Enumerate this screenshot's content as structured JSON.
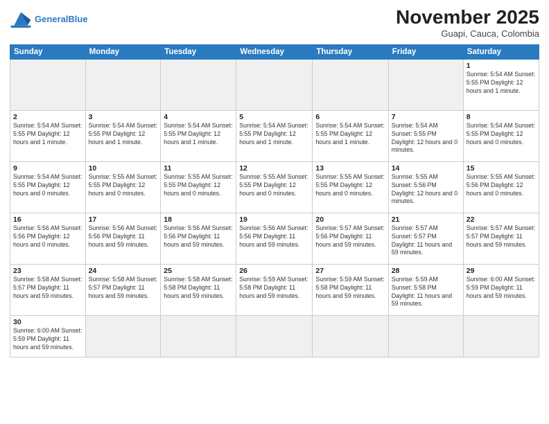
{
  "header": {
    "logo_general": "General",
    "logo_blue": "Blue",
    "month_title": "November 2025",
    "location": "Guapi, Cauca, Colombia"
  },
  "weekdays": [
    "Sunday",
    "Monday",
    "Tuesday",
    "Wednesday",
    "Thursday",
    "Friday",
    "Saturday"
  ],
  "weeks": [
    [
      {
        "day": "",
        "info": ""
      },
      {
        "day": "",
        "info": ""
      },
      {
        "day": "",
        "info": ""
      },
      {
        "day": "",
        "info": ""
      },
      {
        "day": "",
        "info": ""
      },
      {
        "day": "",
        "info": ""
      },
      {
        "day": "1",
        "info": "Sunrise: 5:54 AM\nSunset: 5:55 PM\nDaylight: 12 hours and 1 minute."
      }
    ],
    [
      {
        "day": "2",
        "info": "Sunrise: 5:54 AM\nSunset: 5:55 PM\nDaylight: 12 hours and 1 minute."
      },
      {
        "day": "3",
        "info": "Sunrise: 5:54 AM\nSunset: 5:55 PM\nDaylight: 12 hours and 1 minute."
      },
      {
        "day": "4",
        "info": "Sunrise: 5:54 AM\nSunset: 5:55 PM\nDaylight: 12 hours and 1 minute."
      },
      {
        "day": "5",
        "info": "Sunrise: 5:54 AM\nSunset: 5:55 PM\nDaylight: 12 hours and 1 minute."
      },
      {
        "day": "6",
        "info": "Sunrise: 5:54 AM\nSunset: 5:55 PM\nDaylight: 12 hours and 1 minute."
      },
      {
        "day": "7",
        "info": "Sunrise: 5:54 AM\nSunset: 5:55 PM\nDaylight: 12 hours and 0 minutes."
      },
      {
        "day": "8",
        "info": "Sunrise: 5:54 AM\nSunset: 5:55 PM\nDaylight: 12 hours and 0 minutes."
      }
    ],
    [
      {
        "day": "9",
        "info": "Sunrise: 5:54 AM\nSunset: 5:55 PM\nDaylight: 12 hours and 0 minutes."
      },
      {
        "day": "10",
        "info": "Sunrise: 5:55 AM\nSunset: 5:55 PM\nDaylight: 12 hours and 0 minutes."
      },
      {
        "day": "11",
        "info": "Sunrise: 5:55 AM\nSunset: 5:55 PM\nDaylight: 12 hours and 0 minutes."
      },
      {
        "day": "12",
        "info": "Sunrise: 5:55 AM\nSunset: 5:55 PM\nDaylight: 12 hours and 0 minutes."
      },
      {
        "day": "13",
        "info": "Sunrise: 5:55 AM\nSunset: 5:55 PM\nDaylight: 12 hours and 0 minutes."
      },
      {
        "day": "14",
        "info": "Sunrise: 5:55 AM\nSunset: 5:56 PM\nDaylight: 12 hours and 0 minutes."
      },
      {
        "day": "15",
        "info": "Sunrise: 5:55 AM\nSunset: 5:56 PM\nDaylight: 12 hours and 0 minutes."
      }
    ],
    [
      {
        "day": "16",
        "info": "Sunrise: 5:56 AM\nSunset: 5:56 PM\nDaylight: 12 hours and 0 minutes."
      },
      {
        "day": "17",
        "info": "Sunrise: 5:56 AM\nSunset: 5:56 PM\nDaylight: 11 hours and 59 minutes."
      },
      {
        "day": "18",
        "info": "Sunrise: 5:56 AM\nSunset: 5:56 PM\nDaylight: 11 hours and 59 minutes."
      },
      {
        "day": "19",
        "info": "Sunrise: 5:56 AM\nSunset: 5:56 PM\nDaylight: 11 hours and 59 minutes."
      },
      {
        "day": "20",
        "info": "Sunrise: 5:57 AM\nSunset: 5:56 PM\nDaylight: 11 hours and 59 minutes."
      },
      {
        "day": "21",
        "info": "Sunrise: 5:57 AM\nSunset: 5:57 PM\nDaylight: 11 hours and 59 minutes."
      },
      {
        "day": "22",
        "info": "Sunrise: 5:57 AM\nSunset: 5:57 PM\nDaylight: 11 hours and 59 minutes."
      }
    ],
    [
      {
        "day": "23",
        "info": "Sunrise: 5:58 AM\nSunset: 5:57 PM\nDaylight: 11 hours and 59 minutes."
      },
      {
        "day": "24",
        "info": "Sunrise: 5:58 AM\nSunset: 5:57 PM\nDaylight: 11 hours and 59 minutes."
      },
      {
        "day": "25",
        "info": "Sunrise: 5:58 AM\nSunset: 5:58 PM\nDaylight: 11 hours and 59 minutes."
      },
      {
        "day": "26",
        "info": "Sunrise: 5:59 AM\nSunset: 5:58 PM\nDaylight: 11 hours and 59 minutes."
      },
      {
        "day": "27",
        "info": "Sunrise: 5:59 AM\nSunset: 5:58 PM\nDaylight: 11 hours and 59 minutes."
      },
      {
        "day": "28",
        "info": "Sunrise: 5:59 AM\nSunset: 5:58 PM\nDaylight: 11 hours and 59 minutes."
      },
      {
        "day": "29",
        "info": "Sunrise: 6:00 AM\nSunset: 5:59 PM\nDaylight: 11 hours and 59 minutes."
      }
    ],
    [
      {
        "day": "30",
        "info": "Sunrise: 6:00 AM\nSunset: 5:59 PM\nDaylight: 11 hours and 59 minutes."
      },
      {
        "day": "",
        "info": ""
      },
      {
        "day": "",
        "info": ""
      },
      {
        "day": "",
        "info": ""
      },
      {
        "day": "",
        "info": ""
      },
      {
        "day": "",
        "info": ""
      },
      {
        "day": "",
        "info": ""
      }
    ]
  ]
}
